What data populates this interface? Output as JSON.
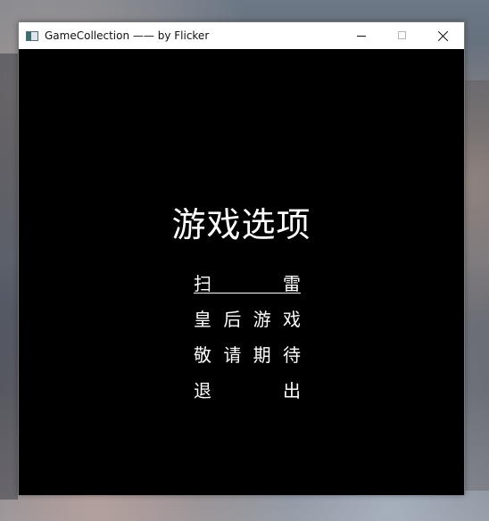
{
  "window": {
    "title": "GameCollection —— by Flicker"
  },
  "menu": {
    "title": "游戏选项",
    "items": [
      {
        "chars": [
          "扫",
          "雷"
        ],
        "selected": true
      },
      {
        "chars": [
          "皇",
          "后",
          "游",
          "戏"
        ],
        "selected": false
      },
      {
        "chars": [
          "敬",
          "请",
          "期",
          "待"
        ],
        "selected": false
      },
      {
        "chars": [
          "退",
          "出"
        ],
        "selected": false
      }
    ]
  },
  "icons": {
    "app": "app-window-icon",
    "minimize": "minimize-icon",
    "maximize": "maximize-icon",
    "close": "close-icon"
  }
}
